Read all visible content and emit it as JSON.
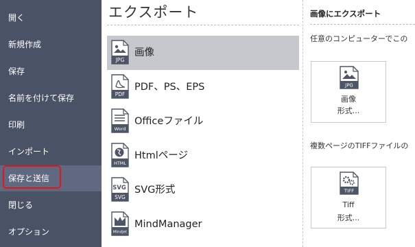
{
  "sidebar": {
    "items": [
      {
        "label": "開く"
      },
      {
        "label": "新規作成"
      },
      {
        "label": "保存"
      },
      {
        "label": "名前を付けて保存"
      },
      {
        "label": "印刷"
      },
      {
        "label": "インポート"
      },
      {
        "label": "保存と送信"
      },
      {
        "label": "閉じる"
      },
      {
        "label": "オプション"
      }
    ],
    "selected_label": "保存と送信"
  },
  "main": {
    "title": "エクスポート",
    "items": [
      {
        "label": "画像",
        "icon": "jpg-image-icon",
        "icon_text": "JPG"
      },
      {
        "label": "PDF、PS、EPS",
        "icon": "pdf-file-icon",
        "icon_text": "PDF"
      },
      {
        "label": "Officeファイル",
        "icon": "word-file-icon",
        "icon_text": "Word"
      },
      {
        "label": "Htmlページ",
        "icon": "html-file-icon",
        "icon_text": "HTML"
      },
      {
        "label": "SVG形式",
        "icon": "svg-file-icon",
        "icon_text": "SVG"
      },
      {
        "label": "MindManager",
        "icon": "mindjet-file-icon",
        "icon_text": "Mindjet"
      }
    ],
    "selected_label": "画像"
  },
  "right": {
    "title": "画像にエクスポート",
    "desc1": "任意のコンピューターでこの",
    "desc2": "複数ページのTIFFファイルの",
    "card1": {
      "icon_text": "JPG",
      "line1": "画像",
      "line2": "形式..."
    },
    "card2": {
      "icon_text": "TIFF",
      "line1": "Tiff",
      "line2": "形式..."
    }
  },
  "colors": {
    "sidebar_bg": "#4a5266",
    "sidebar_selected": "#606980",
    "highlight_box": "#e0181c",
    "item_selected": "#c6c8cd",
    "icon_dark": "#4d5566"
  }
}
